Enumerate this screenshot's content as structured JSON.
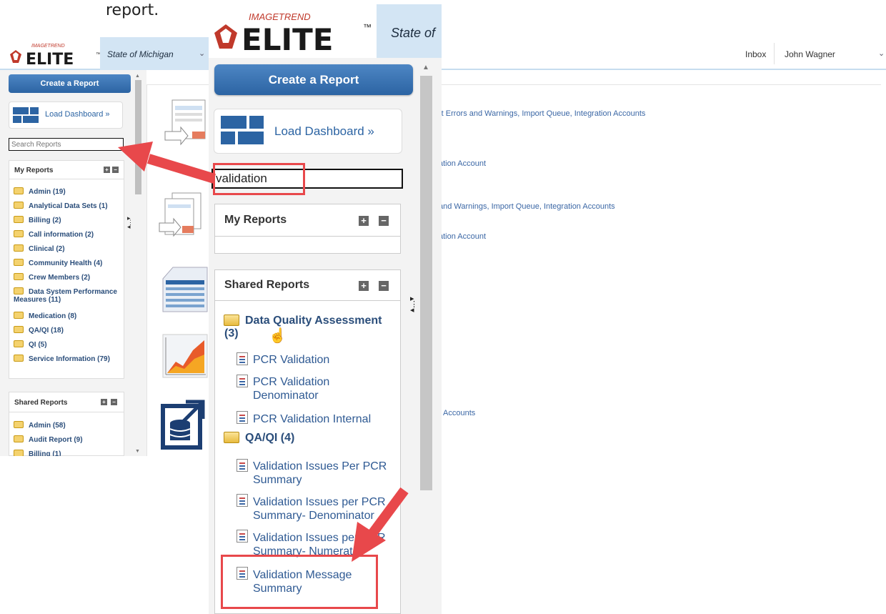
{
  "caption": "report.",
  "app": {
    "logo_brand": "IMAGETREND",
    "logo_name": "ELITE",
    "logo_tm": "™",
    "state": "State of Michigan",
    "state_partial": "State of",
    "inbox": "Inbox",
    "user": "John Wagner"
  },
  "sidebar": {
    "create_report": "Create a Report",
    "load_dashboard": "Load Dashboard »",
    "search_placeholder": "Search Reports",
    "my_reports_title": "My Reports",
    "my_reports": [
      "Admin (19)",
      "Analytical Data Sets (1)",
      "Billing (2)",
      "Call information (2)",
      "Clinical (2)",
      "Community Health (4)",
      "Crew Members (2)",
      "Data System Performance Measures (11)",
      "Medication (8)",
      "QA/QI (18)",
      "QI (5)",
      "Service Information (79)"
    ],
    "shared_reports_title": "Shared Reports",
    "shared_reports": [
      "Admin (58)",
      "Audit Report (9)",
      "Billing (1)"
    ]
  },
  "main": {
    "links": [
      "rt Errors and Warnings, Import Queue, Integration Accounts",
      "ation Account",
      "and Warnings, Import Queue, Integration Accounts",
      "ation Account",
      "Accounts"
    ]
  },
  "zoom": {
    "search_value": "validation",
    "my_reports_title": "My Reports",
    "shared_reports_title": "Shared Reports",
    "group1": "Data Quality Assessment",
    "group1_count": "(3)",
    "group1_items": [
      "PCR Validation",
      "PCR Validation Denominator",
      "PCR Validation Internal"
    ],
    "group2": "QA/QI (4)",
    "group2_items": [
      "Validation Issues Per PCR Summary",
      "Validation Issues per PCR Summary- Denominator",
      "Validation Issues per PCR Summary- Numerator",
      "Validation Message Summary"
    ]
  },
  "colors": {
    "accent": "#2c64a3",
    "annotation_red": "#e8484b",
    "header_blue": "#d3e5f4"
  }
}
